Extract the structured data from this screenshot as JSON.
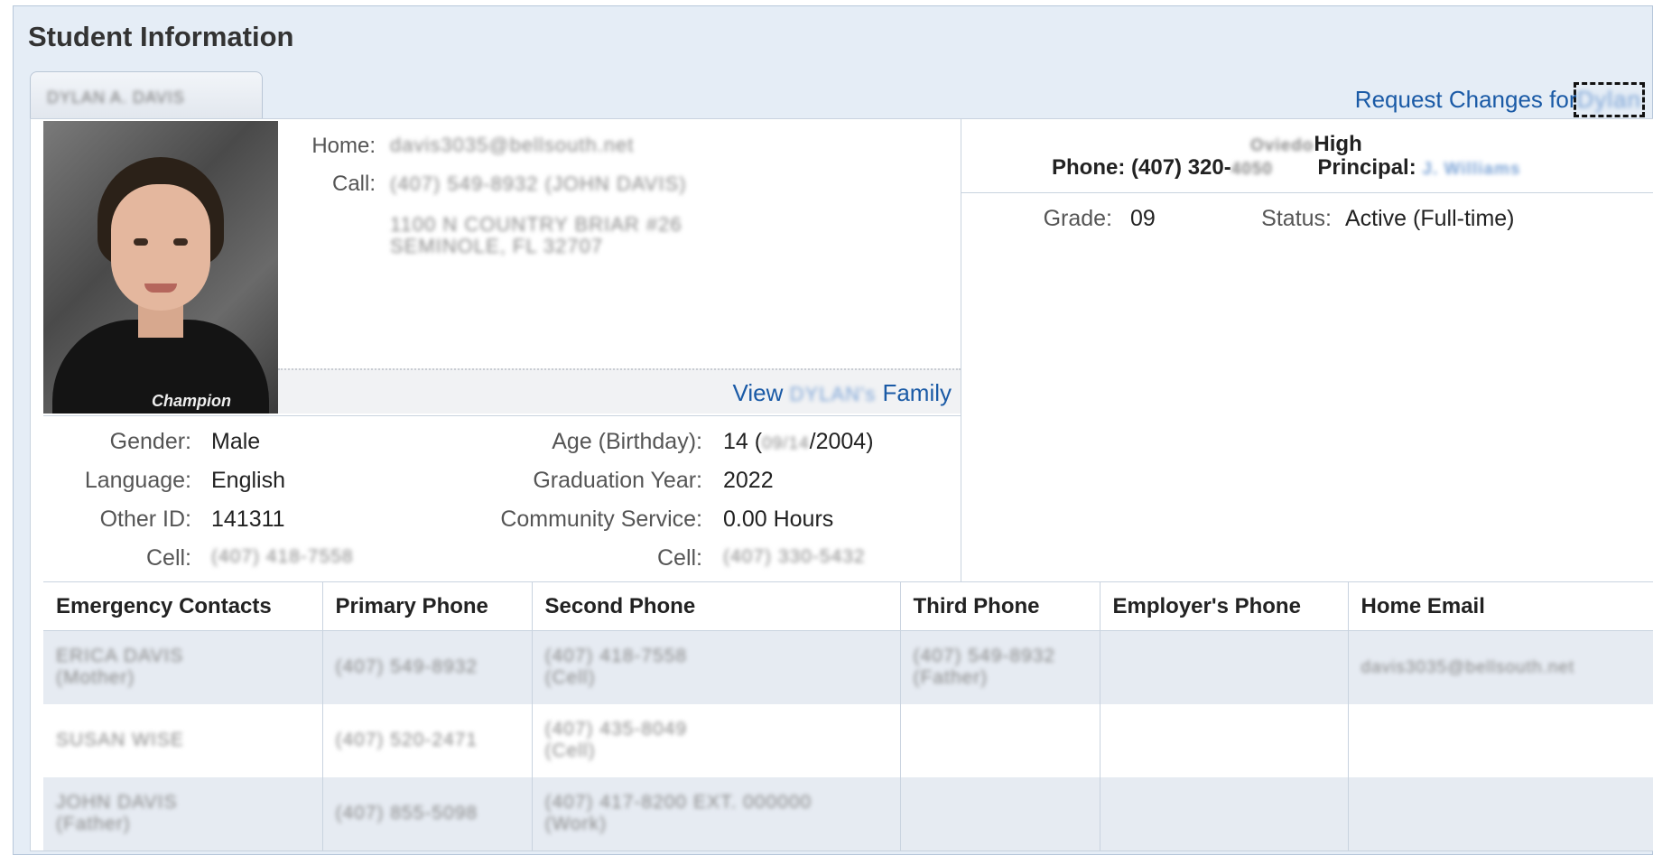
{
  "title": "Student Information",
  "tab": {
    "label": "DYLAN A. DAVIS"
  },
  "request": {
    "text": "Request Changes for",
    "name": "Dylan"
  },
  "contact": {
    "home_label": "Home:",
    "home_value": "davis3035@bellsouth.net",
    "call_label": "Call:",
    "call_value": "(407) 549-8932 (JOHN DAVIS)",
    "address_line1": "1100 N COUNTRY BRIAR #26",
    "address_line2": "SEMINOLE, FL 32707"
  },
  "family": {
    "view": "View",
    "name": "DYLAN's",
    "family": "Family"
  },
  "details": {
    "gender_label": "Gender:",
    "gender": "Male",
    "language_label": "Language:",
    "language": "English",
    "other_id_label": "Other ID:",
    "other_id": "141311",
    "cell_label": "Cell:",
    "cell": "(407) 418-7558",
    "age_label": "Age (Birthday):",
    "age_prefix": "14 (",
    "birth_hidden": "09/14",
    "age_suffix": "/2004)",
    "grad_label": "Graduation Year:",
    "grad": "2022",
    "service_label": "Community Service:",
    "service": "0.00 Hours",
    "cell2_label": "Cell:",
    "cell2": "(407) 330-5432"
  },
  "school": {
    "name_hidden": "Oviedo",
    "name_suffix": "High",
    "phone_label": "Phone:",
    "phone_prefix": "(407) 320-",
    "phone_hidden": "4050",
    "principal_label": "Principal:",
    "principal": "J. Williams",
    "grade_label": "Grade:",
    "grade": "09",
    "status_label": "Status:",
    "status": "Active (Full-time)"
  },
  "emergency": {
    "headers": [
      "Emergency Contacts",
      "Primary Phone",
      "Second Phone",
      "Third Phone",
      "Employer's Phone",
      "Home Email"
    ],
    "rows": [
      [
        "ERICA DAVIS (Mother)",
        "(407) 549-8932",
        "(407) 418-7558 (Cell)",
        "(407) 549-8932 (Father)",
        "",
        "davis3035@bellsouth.net"
      ],
      [
        "SUSAN WISE",
        "(407) 520-2471",
        "(407) 435-8049 (Cell)",
        "",
        "",
        ""
      ],
      [
        "JOHN DAVIS (Father)",
        "(407) 855-5098",
        "(407) 417-8200 EXT. 000000 (Work)",
        "",
        "",
        ""
      ]
    ]
  }
}
